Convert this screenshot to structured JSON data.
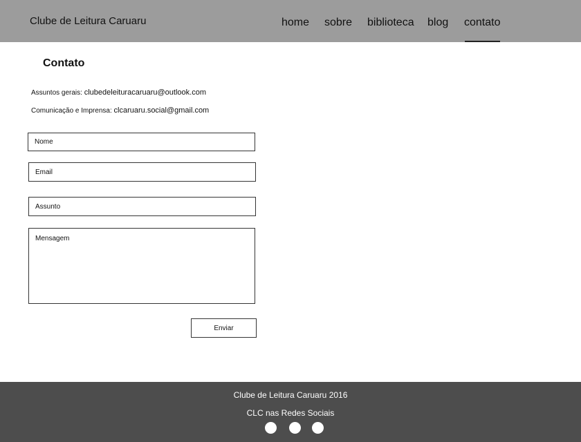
{
  "header": {
    "brand": "Clube de Leitura Caruaru",
    "nav": {
      "home": "home",
      "sobre": "sobre",
      "biblioteca": "biblioteca",
      "blog": "blog",
      "contato": "contato"
    },
    "active_nav": "contato"
  },
  "main": {
    "title": "Contato",
    "contacts": [
      {
        "label": "Assuntos gerais:",
        "email": "clubedeleituracaruaru@outlook.com"
      },
      {
        "label": "Comunicação e Imprensa:",
        "email": "clcaruaru.social@gmail.com"
      }
    ],
    "form": {
      "name_placeholder": "Nome",
      "email_placeholder": "Email",
      "subject_placeholder": "Assunto",
      "message_placeholder": "Mensagem",
      "submit_label": "Enviar"
    }
  },
  "footer": {
    "copyright": "Clube de Leitura Caruaru 2016",
    "social_title": "CLC nas Redes Sociais",
    "social_icons": [
      "social-icon",
      "social-icon",
      "social-icon"
    ]
  },
  "colors": {
    "header_bg": "#9c9c9c",
    "footer_bg": "#4d4d4d",
    "page_bg": "#ffffff"
  }
}
